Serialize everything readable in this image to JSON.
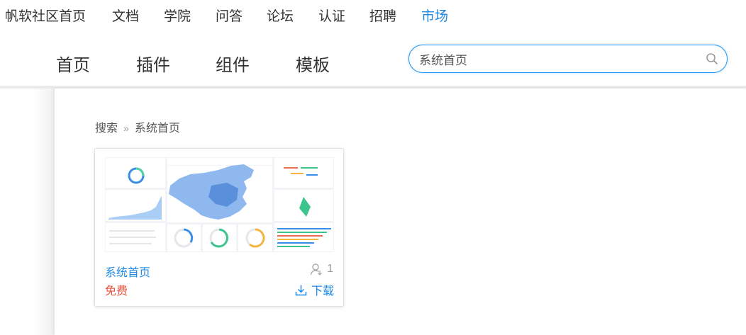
{
  "top_nav": {
    "items": [
      "帆软社区首页",
      "文档",
      "学院",
      "问答",
      "论坛",
      "认证",
      "招聘",
      "市场"
    ]
  },
  "sub_nav": {
    "items": [
      "首页",
      "插件",
      "组件",
      "模板"
    ]
  },
  "search": {
    "value": "系统首页"
  },
  "breadcrumb": {
    "root": "搜索",
    "separator": "»",
    "current": "系统首页"
  },
  "result_card": {
    "title": "系统首页",
    "price": "免费",
    "user_count": "1",
    "download_label": "下载"
  },
  "colors": {
    "accent": "#1e88e5",
    "price": "#e5533d"
  }
}
